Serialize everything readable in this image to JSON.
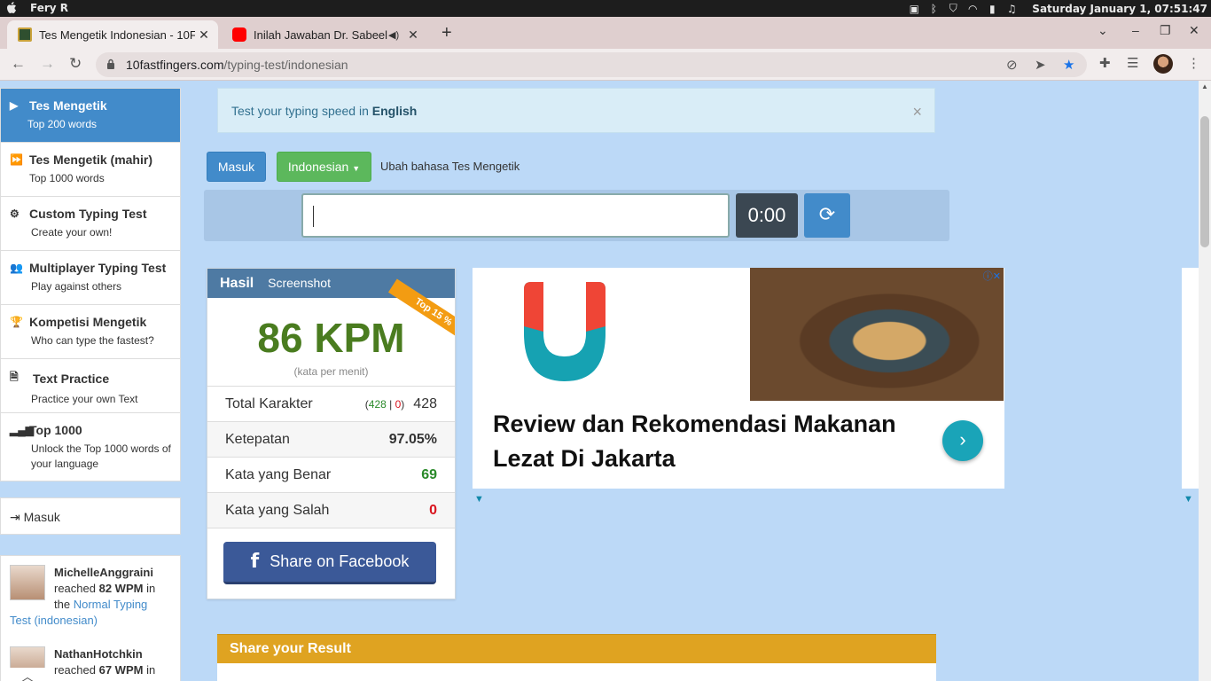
{
  "os": {
    "user": "Fery R",
    "clock": "Saturday January  1, 07:51:47"
  },
  "browser": {
    "tabs": [
      {
        "title": "Tes Mengetik Indonesian - 10F",
        "active": true
      },
      {
        "title": "Inilah Jawaban Dr. Sabeel",
        "active": false
      }
    ],
    "url_host": "10fastfingers.com",
    "url_path": "/typing-test/indonesian"
  },
  "sidebar": {
    "items": [
      {
        "title": "Tes Mengetik",
        "sub": "Top 200 words",
        "icon": "play-icon"
      },
      {
        "title": "Tes Mengetik (mahir)",
        "sub": "Top 1000 words",
        "icon": "fast-forward-icon"
      },
      {
        "title": "Custom Typing Test",
        "sub": "Create your own!",
        "icon": "cogs-icon"
      },
      {
        "title": "Multiplayer Typing Test",
        "sub": "Play against others",
        "icon": "users-icon"
      },
      {
        "title": "Kompetisi Mengetik",
        "sub": "Who can type the fastest?",
        "icon": "trophy-icon"
      },
      {
        "title": "Text Practice",
        "sub": "Practice your own Text",
        "icon": "document-icon"
      },
      {
        "title": "Top 1000",
        "sub": "Unlock the Top 1000 words of your language",
        "icon": "signal-icon"
      }
    ],
    "login": "Masuk",
    "activity": [
      {
        "name": "MichelleAnggraini",
        "reached": "reached",
        "wpm": "82 WPM",
        "in": "in the",
        "link": "Normal Typing Test (indonesian)"
      },
      {
        "name": "NathanHotchkin",
        "reached": "reached",
        "wpm": "67 WPM",
        "in": "in"
      }
    ]
  },
  "notice": {
    "text": "Test your typing speed in",
    "link": "English",
    "close": "×"
  },
  "controls": {
    "login_button": "Masuk",
    "language_button": "Indonesian",
    "language_hint": "Ubah bahasa Tes Mengetik",
    "timer": "0:00"
  },
  "result": {
    "header": "Hasil",
    "screenshot": "Screenshot",
    "ribbon": "Top 15 %",
    "wpm": "86 KPM",
    "wpm_unit": "(kata per menit)",
    "rows": [
      {
        "label": "Total Karakter",
        "correct": "428",
        "wrong": "0",
        "value": "428"
      },
      {
        "label": "Ketepatan",
        "value": "97.05%"
      },
      {
        "label": "Kata yang Benar",
        "value": "69"
      },
      {
        "label": "Kata yang Salah",
        "value": "0"
      }
    ],
    "facebook": "Share on Facebook"
  },
  "ad": {
    "headline": "Review dan Rekomendasi Makanan Lezat Di Jakarta"
  },
  "share_result": {
    "title": "Share your Result"
  },
  "colors": {
    "primary": "#428bca",
    "success": "#5cb85c",
    "kpm_green": "#4a7c1f",
    "correct_green": "#2a8a2a",
    "wrong_red": "#d9141e",
    "facebook": "#3b5998",
    "share_gold": "#dfa321"
  }
}
